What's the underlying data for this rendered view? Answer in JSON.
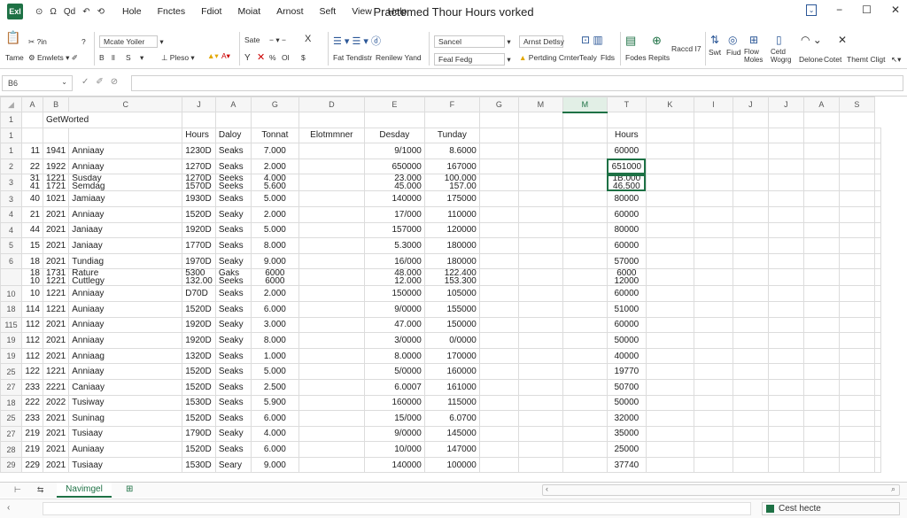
{
  "titlebar": {
    "app_badge": "Exl",
    "quick_access": [
      "⊙",
      "Ω",
      "Qd",
      "↶",
      "⟲"
    ],
    "menu": [
      "Hole",
      "Fnctes",
      "Fdiot",
      "Moiat",
      "Arnost",
      "Seft",
      "View",
      "Help"
    ],
    "doc_title": "Practemed Thour Hours vorked",
    "controls": [
      "−",
      "☐",
      "✕"
    ]
  },
  "ribbon": {
    "clipboard": {
      "top": "?in",
      "bottom": "Enwlets",
      "tall": "Tame",
      "q": "?"
    },
    "font": {
      "font_name": "Mcate Yoiler",
      "font_size": "",
      "bold": "B",
      "italic": "I",
      "s": "S",
      "mid_a": "ll",
      "fill": "Pleso",
      "font_color": "A"
    },
    "align": {
      "top": "Fcrnts Fctcs",
      "sate": "Sate",
      "x": "X",
      "bottom": "Y",
      "of": "Ol",
      "percent": "%",
      "dollar": "$"
    },
    "number": {
      "top": "Sancel",
      "fat": "Fat Tendistr",
      "review": "Renilew Yand",
      "feal": "Feal Fedg"
    },
    "styles": {
      "top": "Arnst Detlsy",
      "cond": "Pertding Crnter",
      "tealy": "Tealy",
      "flds": "Flds"
    },
    "cells": {
      "fodes": "Fodes",
      "repits": "Repits",
      "raccd": "Raccd I7"
    },
    "editing": {
      "swt": "Swt",
      "find": "Fiud",
      "flow": "Flow Moles",
      "detd": "Cetd Wogrg",
      "delone": "Delone",
      "cotet": "Cotet",
      "theme": "Themt Cligt"
    }
  },
  "formula_bar": {
    "name_box": "B6",
    "fx": "fx",
    "value": ""
  },
  "columns": [
    "A",
    "B",
    "C",
    "J",
    "A",
    "G",
    "D",
    "E",
    "F",
    "G",
    "M",
    "M",
    "T",
    "K",
    "I",
    "J",
    "J",
    "A",
    "S"
  ],
  "selected_column_index": 11,
  "sheet": {
    "title_cell": "GetWorted",
    "headers": {
      "c": "Hours",
      "j": "Daloy",
      "a": "Tonnat",
      "g": "Elotmmner",
      "d": "Desday",
      "e": "Tunday",
      "m2": "Hours"
    },
    "rows": [
      {
        "rh": "1",
        "a": "11",
        "a2": "1941",
        "b": "Anniaay",
        "c": "1230D",
        "j": "Seaks",
        "aa": "7.000",
        "g": "",
        "d": "9/1000",
        "e": "8.6000",
        "m": "60000"
      },
      {
        "rh": "2",
        "a": "22",
        "a2": "1922",
        "b": "Anniaay",
        "c": "1270D",
        "j": "Seaks",
        "aa": "2.000",
        "g": "",
        "d": "650000",
        "e": "167000",
        "m": "651000",
        "sel": true
      },
      {
        "rh": "3",
        "two": true,
        "a": "31",
        "a2": "1221",
        "b": "Susday",
        "c": "1270D",
        "j": "Seeks",
        "aa": "4.000",
        "d": "23.000",
        "e": "100.000",
        "m": "1B.000",
        "a_2": "41",
        "a2_2": "1721",
        "b_2": "Semdag",
        "c_2": "1570D",
        "j_2": "Seeks",
        "aa_2": "5.600",
        "d_2": "45.000",
        "e_2": "157.00",
        "m_2": "46.500",
        "sel": true
      },
      {
        "rh": "3",
        "a": "40",
        "a2": "1021",
        "b": "Jamiaay",
        "c": "1930D",
        "j": "Seaks",
        "aa": "5.000",
        "d": "140000",
        "e": "175000",
        "m": "80000"
      },
      {
        "rh": "4",
        "a": "21",
        "a2": "2021",
        "b": "Anniaay",
        "c": "1520D",
        "j": "Seaky",
        "aa": "2.000",
        "d": "17/000",
        "e": "110000",
        "m": "60000"
      },
      {
        "rh": "4",
        "a": "44",
        "a2": "2021",
        "b": "Janiaay",
        "c": "1920D",
        "j": "Seaks",
        "aa": "5.000",
        "d": "157000",
        "e": "120000",
        "m": "80000"
      },
      {
        "rh": "5",
        "a": "15",
        "a2": "2021",
        "b": "Janiaay",
        "c": "1770D",
        "j": "Seaks",
        "aa": "8.000",
        "d": "5.3000",
        "e": "180000",
        "m": "60000"
      },
      {
        "rh": "6",
        "a": "18",
        "a2": "2021",
        "b": "Tundiag",
        "c": "1970D",
        "j": "Seaky",
        "aa": "9.000",
        "d": "16/000",
        "e": "180000",
        "m": "57000"
      },
      {
        "rh": "",
        "two": true,
        "a": "18",
        "a2": "1731",
        "b": "Rature",
        "c": "5300",
        "j": "Gaks",
        "aa": "6000",
        "d": "48.000",
        "e": "122.400",
        "m": "6000",
        "a_2": "10",
        "a2_2": "1221",
        "b_2": "Cuttlegy",
        "c_2": "132.00",
        "j_2": "Seeks",
        "aa_2": "6000",
        "d_2": "12.000",
        "e_2": "153.300",
        "m_2": "12000"
      },
      {
        "rh": "10",
        "a": "10",
        "a2": "1221",
        "b": "Anniaay",
        "c": "D70D",
        "j": "Seaks",
        "aa": "2.000",
        "d": "150000",
        "e": "105000",
        "m": "60000"
      },
      {
        "rh": "18",
        "a": "114",
        "a2": "1221",
        "b": "Auniaay",
        "c": "1520D",
        "j": "Seaks",
        "aa": "6.000",
        "d": "9/0000",
        "e": "155000",
        "m": "51000"
      },
      {
        "rh": "115",
        "a": "112",
        "a2": "2021",
        "b": "Anniaay",
        "c": "1920D",
        "j": "Seaky",
        "aa": "3.000",
        "d": "47.000",
        "e": "150000",
        "m": "60000"
      },
      {
        "rh": "19",
        "a": "112",
        "a2": "2021",
        "b": "Anniaay",
        "c": "1920D",
        "j": "Seaky",
        "aa": "8.000",
        "d": "3/0000",
        "e": "0/0000",
        "m": "50000"
      },
      {
        "rh": "19",
        "a": "112",
        "a2": "2021",
        "b": "Anniaag",
        "c": "1320D",
        "j": "Seaks",
        "aa": "1.000",
        "d": "8.0000",
        "e": "170000",
        "m": "40000"
      },
      {
        "rh": "25",
        "a": "122",
        "a2": "1221",
        "b": "Anniaay",
        "c": "1520D",
        "j": "Seaks",
        "aa": "5.000",
        "d": "5/0000",
        "e": "160000",
        "m": "19770"
      },
      {
        "rh": "27",
        "a": "233",
        "a2": "2221",
        "b": "Caniaay",
        "c": "1520D",
        "j": "Seaks",
        "aa": "2.500",
        "d": "6.0007",
        "e": "161000",
        "m": "50700"
      },
      {
        "rh": "18",
        "a": "222",
        "a2": "2022",
        "b": "Tusiway",
        "c": "1530D",
        "j": "Seaks",
        "aa": "5.900",
        "d": "160000",
        "e": "115000",
        "m": "50000"
      },
      {
        "rh": "25",
        "a": "233",
        "a2": "2021",
        "b": "Suninag",
        "c": "1520D",
        "j": "Seaks",
        "aa": "6.000",
        "d": "15/000",
        "e": "6.0700",
        "m": "32000"
      },
      {
        "rh": "27",
        "a": "219",
        "a2": "2021",
        "b": "Tusiaay",
        "c": "1790D",
        "j": "Seaky",
        "aa": "4.000",
        "d": "9/0000",
        "e": "145000",
        "m": "35000"
      },
      {
        "rh": "28",
        "a": "219",
        "a2": "2021",
        "b": "Auniaay",
        "c": "1520D",
        "j": "Seaks",
        "aa": "6.000",
        "d": "10/000",
        "e": "147000",
        "m": "25000"
      },
      {
        "rh": "29",
        "a": "229",
        "a2": "2021",
        "b": "Tusiaay",
        "c": "1530D",
        "j": "Seary",
        "aa": "9.000",
        "d": "140000",
        "e": "100000",
        "m": "37740"
      }
    ]
  },
  "sheet_tabs": {
    "nav": [
      "⊢",
      "⇆"
    ],
    "active": "Navimgel",
    "add": "⊞"
  },
  "status": {
    "left": "‹",
    "ready": "Cest hecte"
  },
  "colors": {
    "accent": "#1e7145"
  }
}
